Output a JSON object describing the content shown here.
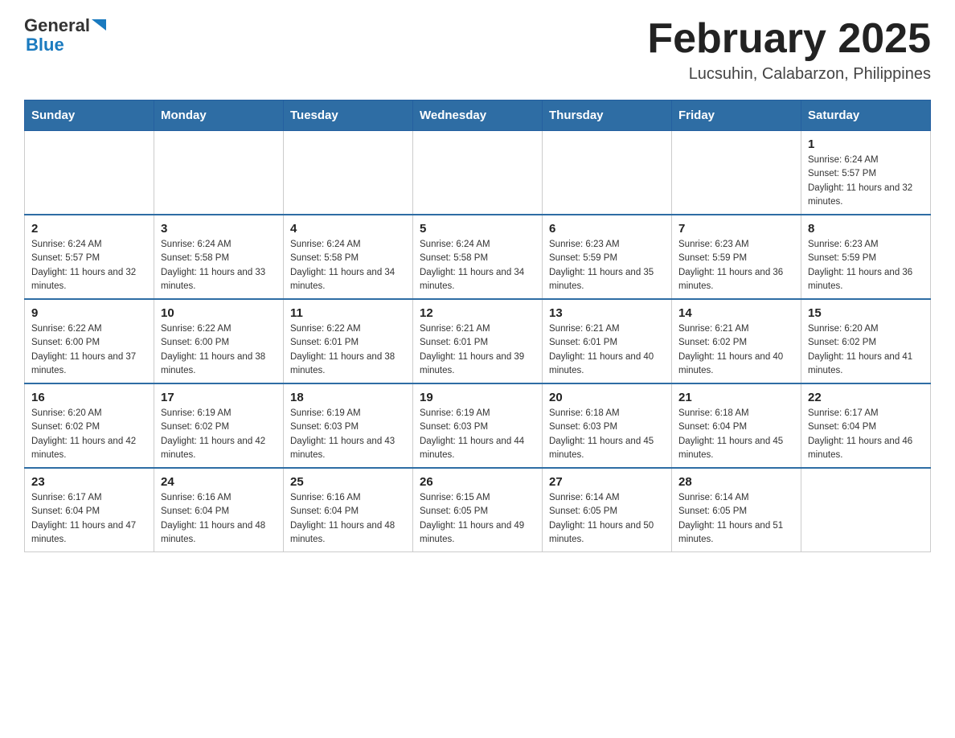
{
  "header": {
    "logo": {
      "general": "General",
      "blue": "Blue"
    },
    "title": "February 2025",
    "location": "Lucsuhin, Calabarzon, Philippines"
  },
  "days_of_week": [
    "Sunday",
    "Monday",
    "Tuesday",
    "Wednesday",
    "Thursday",
    "Friday",
    "Saturday"
  ],
  "weeks": [
    [
      {
        "day": "",
        "info": ""
      },
      {
        "day": "",
        "info": ""
      },
      {
        "day": "",
        "info": ""
      },
      {
        "day": "",
        "info": ""
      },
      {
        "day": "",
        "info": ""
      },
      {
        "day": "",
        "info": ""
      },
      {
        "day": "1",
        "info": "Sunrise: 6:24 AM\nSunset: 5:57 PM\nDaylight: 11 hours and 32 minutes."
      }
    ],
    [
      {
        "day": "2",
        "info": "Sunrise: 6:24 AM\nSunset: 5:57 PM\nDaylight: 11 hours and 32 minutes."
      },
      {
        "day": "3",
        "info": "Sunrise: 6:24 AM\nSunset: 5:58 PM\nDaylight: 11 hours and 33 minutes."
      },
      {
        "day": "4",
        "info": "Sunrise: 6:24 AM\nSunset: 5:58 PM\nDaylight: 11 hours and 34 minutes."
      },
      {
        "day": "5",
        "info": "Sunrise: 6:24 AM\nSunset: 5:58 PM\nDaylight: 11 hours and 34 minutes."
      },
      {
        "day": "6",
        "info": "Sunrise: 6:23 AM\nSunset: 5:59 PM\nDaylight: 11 hours and 35 minutes."
      },
      {
        "day": "7",
        "info": "Sunrise: 6:23 AM\nSunset: 5:59 PM\nDaylight: 11 hours and 36 minutes."
      },
      {
        "day": "8",
        "info": "Sunrise: 6:23 AM\nSunset: 5:59 PM\nDaylight: 11 hours and 36 minutes."
      }
    ],
    [
      {
        "day": "9",
        "info": "Sunrise: 6:22 AM\nSunset: 6:00 PM\nDaylight: 11 hours and 37 minutes."
      },
      {
        "day": "10",
        "info": "Sunrise: 6:22 AM\nSunset: 6:00 PM\nDaylight: 11 hours and 38 minutes."
      },
      {
        "day": "11",
        "info": "Sunrise: 6:22 AM\nSunset: 6:01 PM\nDaylight: 11 hours and 38 minutes."
      },
      {
        "day": "12",
        "info": "Sunrise: 6:21 AM\nSunset: 6:01 PM\nDaylight: 11 hours and 39 minutes."
      },
      {
        "day": "13",
        "info": "Sunrise: 6:21 AM\nSunset: 6:01 PM\nDaylight: 11 hours and 40 minutes."
      },
      {
        "day": "14",
        "info": "Sunrise: 6:21 AM\nSunset: 6:02 PM\nDaylight: 11 hours and 40 minutes."
      },
      {
        "day": "15",
        "info": "Sunrise: 6:20 AM\nSunset: 6:02 PM\nDaylight: 11 hours and 41 minutes."
      }
    ],
    [
      {
        "day": "16",
        "info": "Sunrise: 6:20 AM\nSunset: 6:02 PM\nDaylight: 11 hours and 42 minutes."
      },
      {
        "day": "17",
        "info": "Sunrise: 6:19 AM\nSunset: 6:02 PM\nDaylight: 11 hours and 42 minutes."
      },
      {
        "day": "18",
        "info": "Sunrise: 6:19 AM\nSunset: 6:03 PM\nDaylight: 11 hours and 43 minutes."
      },
      {
        "day": "19",
        "info": "Sunrise: 6:19 AM\nSunset: 6:03 PM\nDaylight: 11 hours and 44 minutes."
      },
      {
        "day": "20",
        "info": "Sunrise: 6:18 AM\nSunset: 6:03 PM\nDaylight: 11 hours and 45 minutes."
      },
      {
        "day": "21",
        "info": "Sunrise: 6:18 AM\nSunset: 6:04 PM\nDaylight: 11 hours and 45 minutes."
      },
      {
        "day": "22",
        "info": "Sunrise: 6:17 AM\nSunset: 6:04 PM\nDaylight: 11 hours and 46 minutes."
      }
    ],
    [
      {
        "day": "23",
        "info": "Sunrise: 6:17 AM\nSunset: 6:04 PM\nDaylight: 11 hours and 47 minutes."
      },
      {
        "day": "24",
        "info": "Sunrise: 6:16 AM\nSunset: 6:04 PM\nDaylight: 11 hours and 48 minutes."
      },
      {
        "day": "25",
        "info": "Sunrise: 6:16 AM\nSunset: 6:04 PM\nDaylight: 11 hours and 48 minutes."
      },
      {
        "day": "26",
        "info": "Sunrise: 6:15 AM\nSunset: 6:05 PM\nDaylight: 11 hours and 49 minutes."
      },
      {
        "day": "27",
        "info": "Sunrise: 6:14 AM\nSunset: 6:05 PM\nDaylight: 11 hours and 50 minutes."
      },
      {
        "day": "28",
        "info": "Sunrise: 6:14 AM\nSunset: 6:05 PM\nDaylight: 11 hours and 51 minutes."
      },
      {
        "day": "",
        "info": ""
      }
    ]
  ]
}
